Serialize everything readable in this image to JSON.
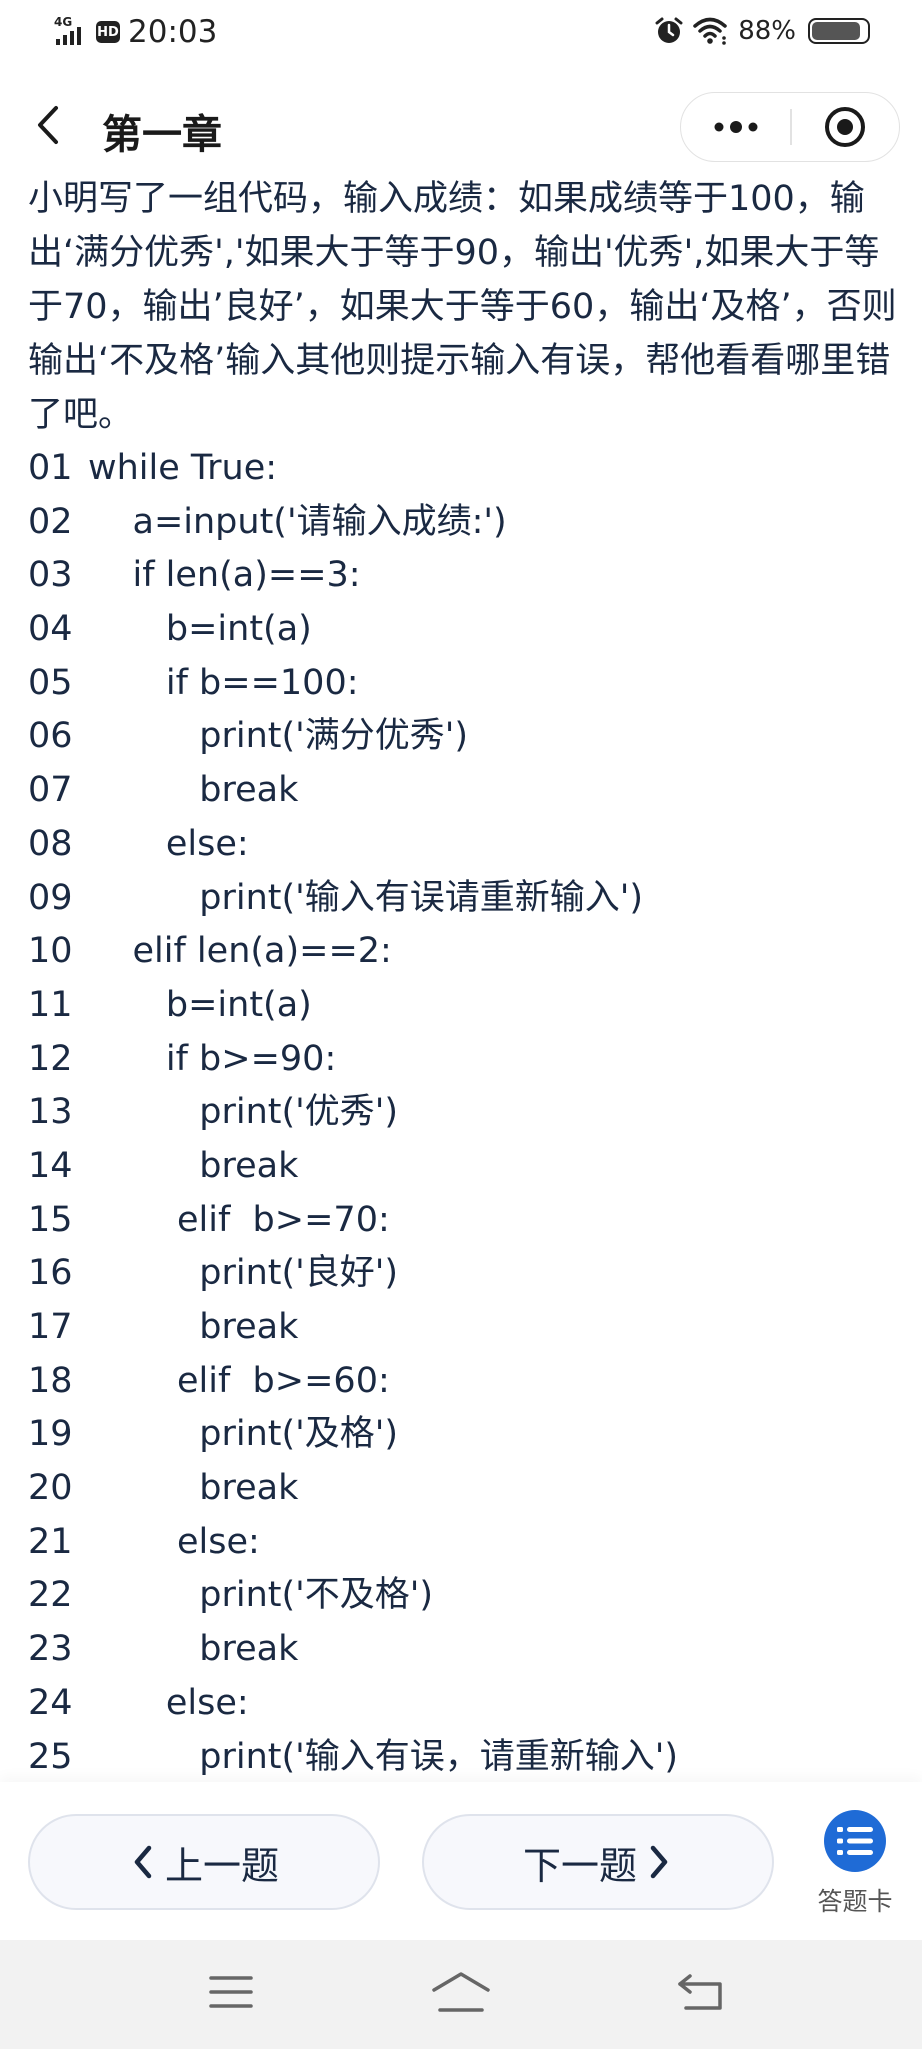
{
  "status_bar": {
    "network": "4G",
    "hd": "HD",
    "time": "20:03",
    "battery_percent": "88%",
    "battery_level": 0.88,
    "icons": [
      "alarm-icon",
      "wifi-icon",
      "battery-icon"
    ]
  },
  "nav": {
    "title": "第一章",
    "back_icon": "chevron-left-icon",
    "more_icon": "more-dots-icon",
    "close_icon": "target-circle-icon"
  },
  "question": {
    "text": "小明写了一组代码，输入成绩：如果成绩等于100，输出‘满分优秀','如果大于等于90，输出'优秀',如果大于等于70，输出’良好’，如果大于等于60，输出‘及格’，否则输出‘不及格’输入其他则提示输入有误，帮他看看哪里错了吧。",
    "code_lines": [
      {
        "num": "01",
        "text": "while True:"
      },
      {
        "num": "02",
        "text": "    a=input('请输入成绩:')"
      },
      {
        "num": "03",
        "text": "    if len(a)==3:"
      },
      {
        "num": "04",
        "text": "       b=int(a)"
      },
      {
        "num": "05",
        "text": "       if b==100:"
      },
      {
        "num": "06",
        "text": "          print('满分优秀')"
      },
      {
        "num": "07",
        "text": "          break"
      },
      {
        "num": "08",
        "text": "       else:"
      },
      {
        "num": "09",
        "text": "          print('输入有误请重新输入')"
      },
      {
        "num": "10",
        "text": "    elif len(a)==2:"
      },
      {
        "num": "11",
        "text": "       b=int(a)"
      },
      {
        "num": "12",
        "text": "       if b>=90:"
      },
      {
        "num": "13",
        "text": "          print('优秀')"
      },
      {
        "num": "14",
        "text": "          break"
      },
      {
        "num": "15",
        "text": "        elif  b>=70:"
      },
      {
        "num": "16",
        "text": "          print('良好')"
      },
      {
        "num": "17",
        "text": "          break"
      },
      {
        "num": "18",
        "text": "        elif  b>=60:"
      },
      {
        "num": "19",
        "text": "          print('及格')"
      },
      {
        "num": "20",
        "text": "          break"
      },
      {
        "num": "21",
        "text": "        else:"
      },
      {
        "num": "22",
        "text": "          print('不及格')"
      },
      {
        "num": "23",
        "text": "          break"
      },
      {
        "num": "24",
        "text": "       else:"
      },
      {
        "num": "25",
        "text": "          print('输入有误，请重新输入')"
      }
    ]
  },
  "actions": {
    "prev_label": "上一题",
    "next_label": "下一题",
    "answer_card_label": "答题卡",
    "accent_color": "#1f6bd6"
  }
}
